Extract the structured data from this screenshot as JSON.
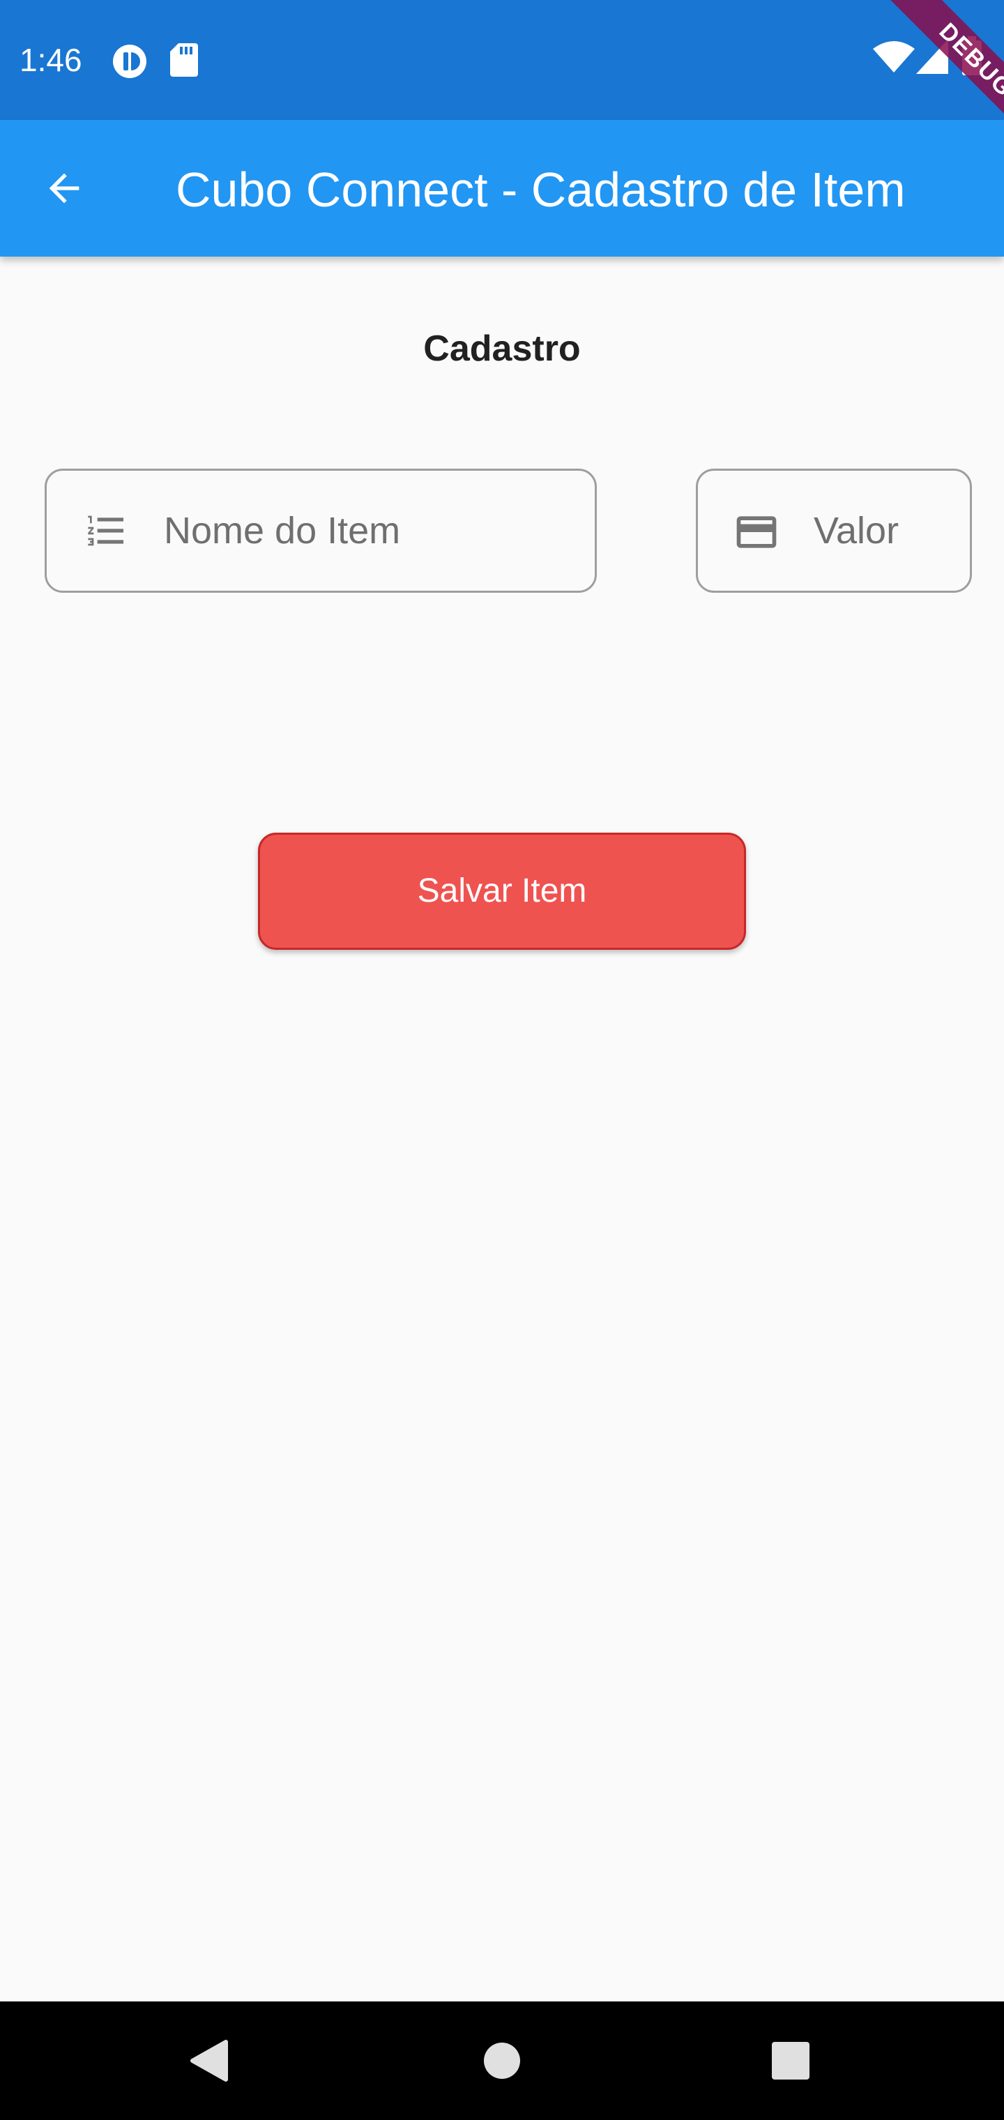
{
  "status_bar": {
    "time": "1:46",
    "left_icons": [
      "sync-badge-icon",
      "sd-card-icon"
    ],
    "right_icons": [
      "wifi-icon",
      "cell-signal-icon",
      "battery-icon"
    ],
    "background": "#1976d2"
  },
  "debug_banner": {
    "label": "DEBUG"
  },
  "app_bar": {
    "title": "Cubo Connect - Cadastro de Item",
    "back_icon": "arrow-back-icon",
    "background": "#2196f3"
  },
  "form": {
    "heading": "Cadastro",
    "name_field": {
      "placeholder": "Nome do Item",
      "value": "",
      "icon": "format-list-numbered-icon"
    },
    "value_field": {
      "placeholder": "Valor",
      "value": "",
      "icon": "credit-card-icon"
    },
    "save_button": {
      "label": "Salvar Item",
      "color": "#ef5350"
    }
  },
  "nav_bar": {
    "buttons": [
      "back-triangle-icon",
      "home-circle-icon",
      "recents-square-icon"
    ]
  }
}
